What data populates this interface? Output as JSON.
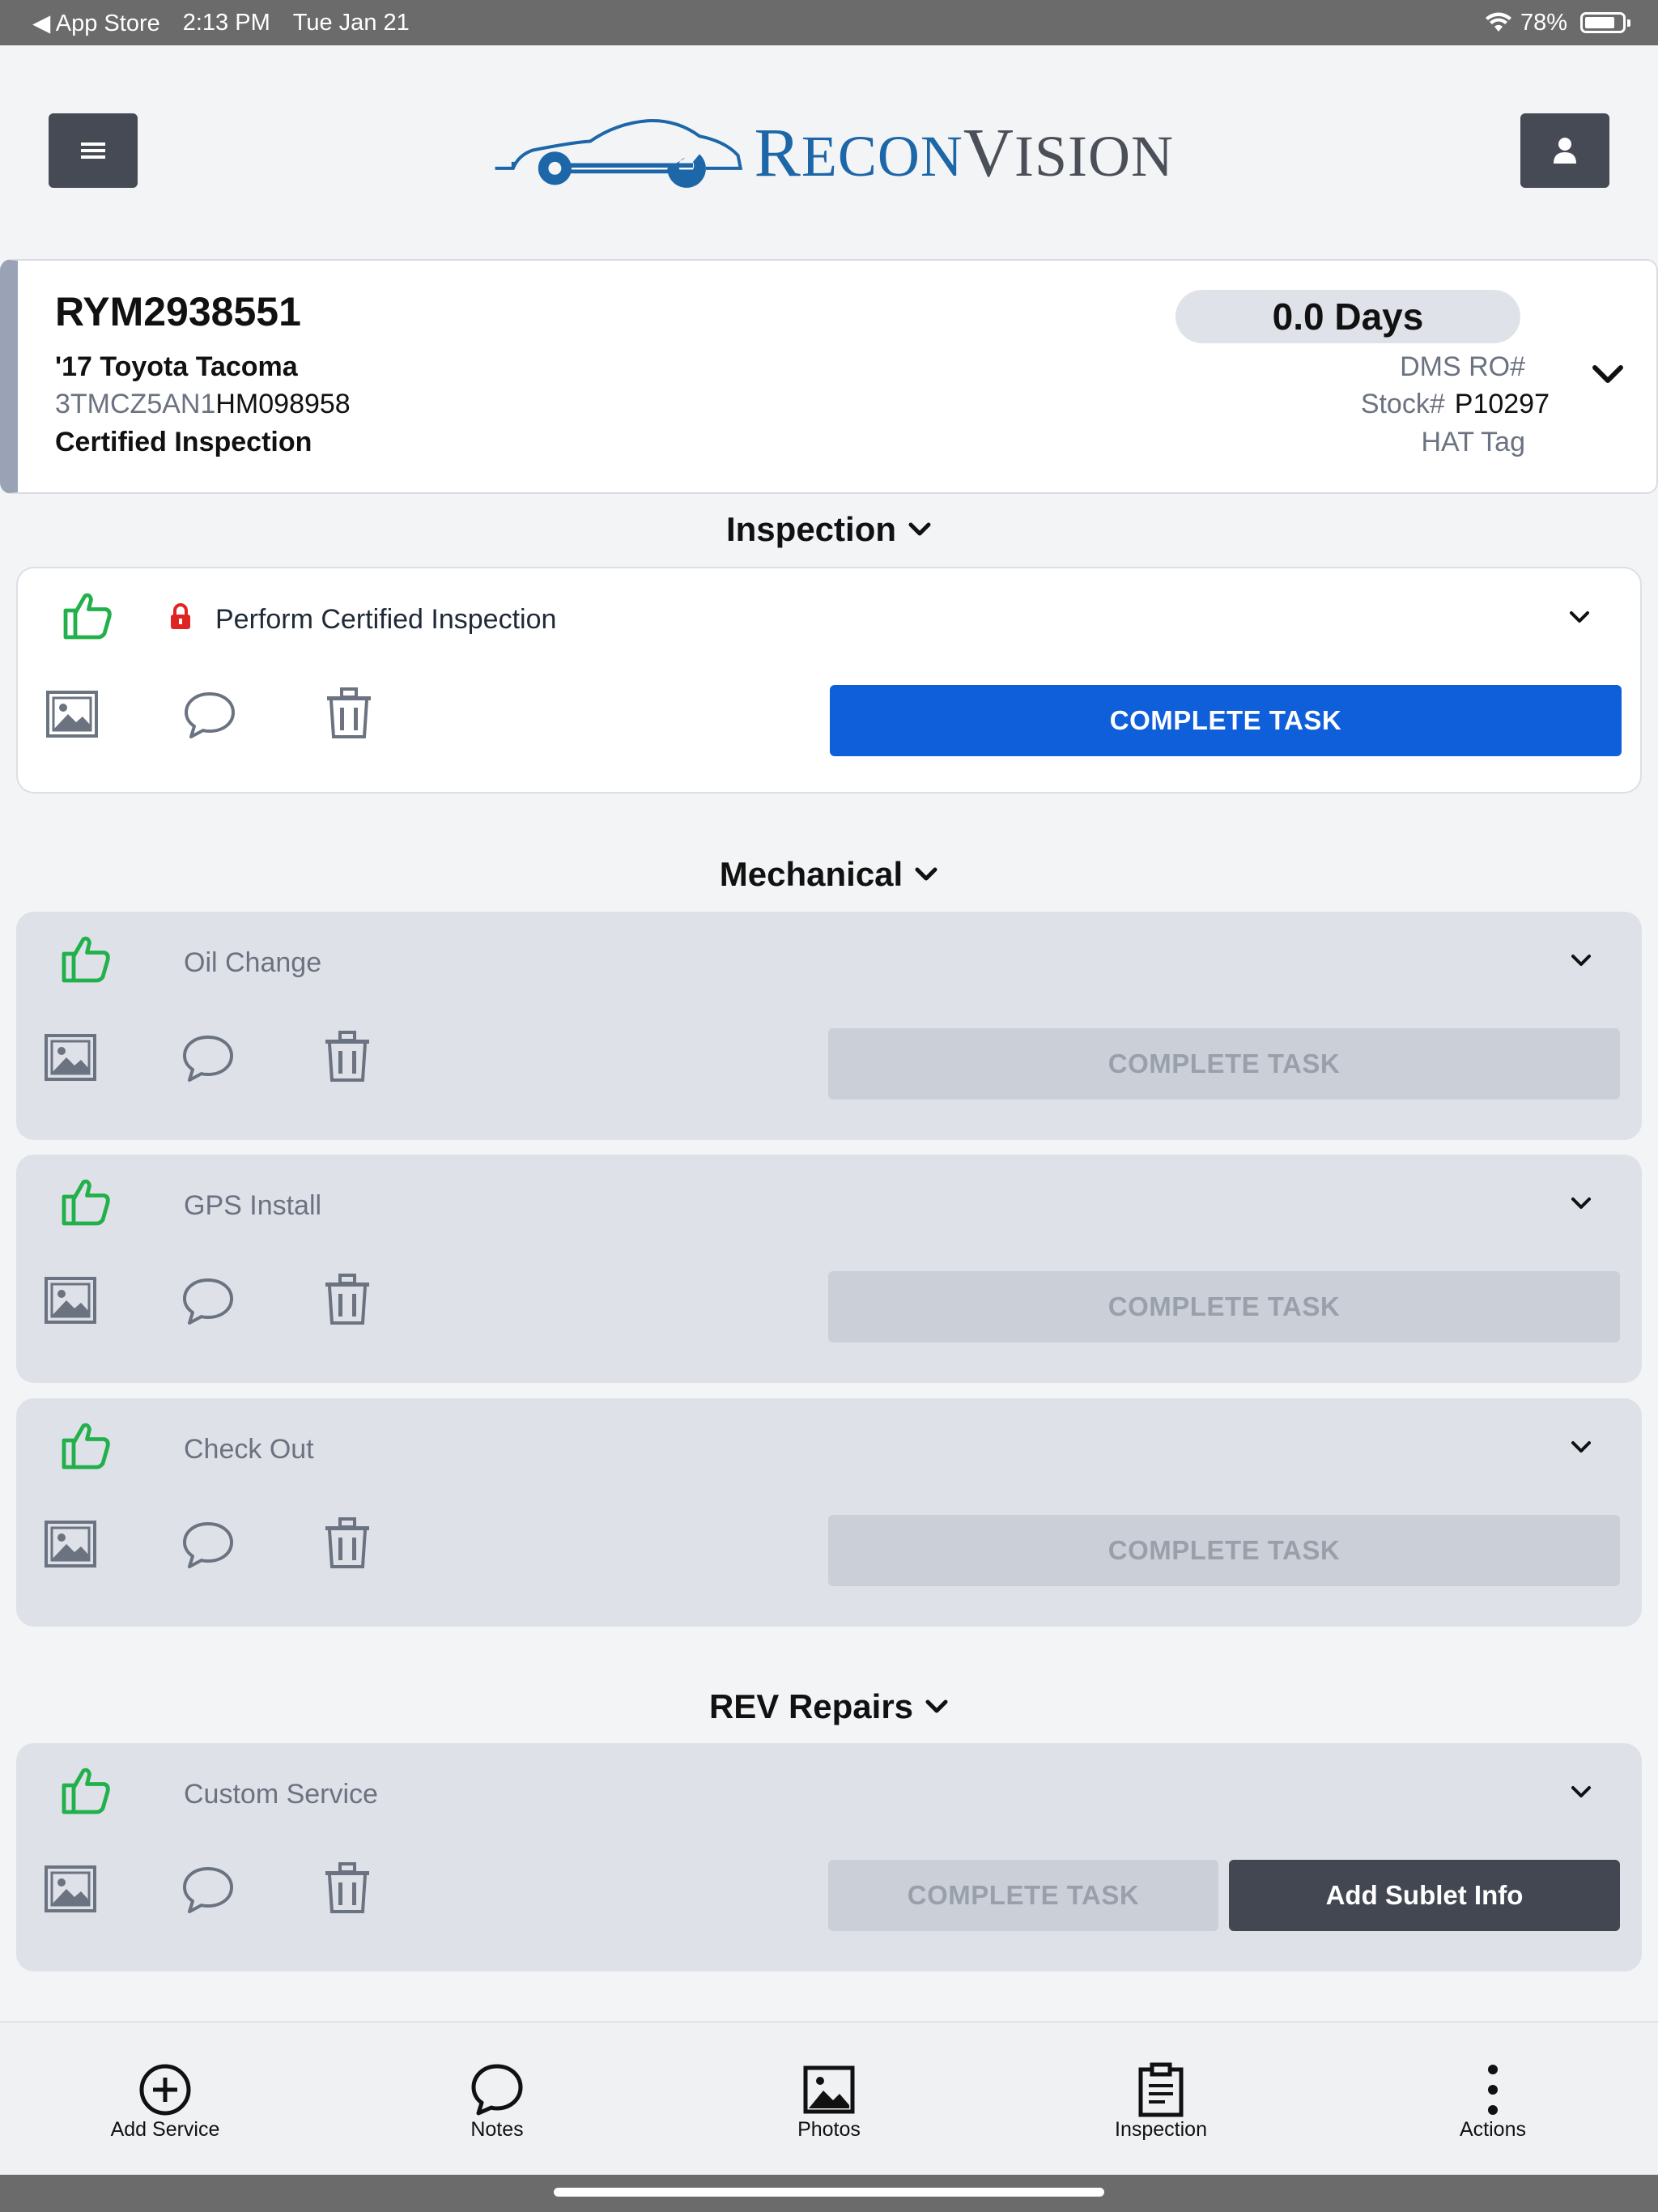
{
  "status_bar": {
    "back_app": "◀ App Store",
    "time": "2:13 PM",
    "date": "Tue Jan 21",
    "battery": "78%",
    "battery_level": 0.78
  },
  "header": {
    "logo_first": "R",
    "logo_mid": "ECON",
    "logo_second": "V",
    "logo_end": "ISION",
    "brand_color": "#1d67a8"
  },
  "vehicle": {
    "stock_id": "RYM2938551",
    "model": "'17 Toyota Tacoma",
    "vin_prefix": "3TMCZ5AN1",
    "vin_suffix": "HM098958",
    "inspection_type": "Certified Inspection",
    "days": "0.0 Days",
    "dms_ro_label": "DMS RO#",
    "dms_ro_value": "",
    "stock_label": "Stock#",
    "stock_value": "P10297",
    "hat_tag_label": "HAT Tag",
    "hat_tag_value": ""
  },
  "sections": {
    "inspection": {
      "title": "Inspection",
      "tasks": [
        {
          "name": "Perform Certified Inspection",
          "button": "COMPLETE TASK",
          "locked": true
        }
      ]
    },
    "mechanical": {
      "title": "Mechanical",
      "tasks": [
        {
          "name": "Oil Change",
          "button": "COMPLETE TASK"
        },
        {
          "name": "GPS Install",
          "button": "COMPLETE TASK"
        },
        {
          "name": "Check Out",
          "button": "COMPLETE TASK"
        }
      ]
    },
    "rev_repairs": {
      "title": "REV Repairs",
      "tasks": [
        {
          "name": "Custom Service",
          "button": "COMPLETE TASK",
          "secondary_button": "Add Sublet Info"
        }
      ]
    }
  },
  "tabbar": {
    "items": [
      {
        "label": "Add Service",
        "icon": "add-circle-icon"
      },
      {
        "label": "Notes",
        "icon": "chat-bubble-icon"
      },
      {
        "label": "Photos",
        "icon": "image-icon"
      },
      {
        "label": "Inspection",
        "icon": "clipboard-icon"
      },
      {
        "label": "Actions",
        "icon": "more-vertical-icon"
      }
    ]
  },
  "colors": {
    "primary_button": "#0e5fd9",
    "thumb_green": "#22b04b",
    "lock_red": "#e02424",
    "dark_button": "#424752"
  }
}
